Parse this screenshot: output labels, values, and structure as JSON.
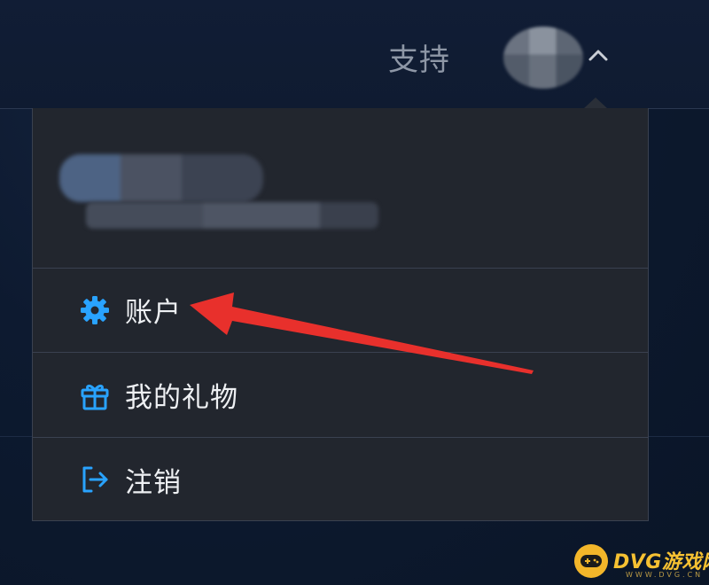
{
  "header": {
    "support_label": "支持",
    "avatar_icon": "user-avatar",
    "toggle_icon": "chevron-up-icon"
  },
  "dropdown": {
    "items": [
      {
        "label": "账户",
        "icon": "gear-icon"
      },
      {
        "label": "我的礼物",
        "icon": "gift-icon"
      },
      {
        "label": "注销",
        "icon": "logout-icon"
      }
    ]
  },
  "colors": {
    "accent_blue": "#29a3ff",
    "annotation_red": "#e8302c",
    "panel_bg": "#22262e",
    "header_bg": "#111d35"
  },
  "watermark": {
    "brand": "DVG游戏网",
    "url": "WWW.DVG.CN"
  }
}
